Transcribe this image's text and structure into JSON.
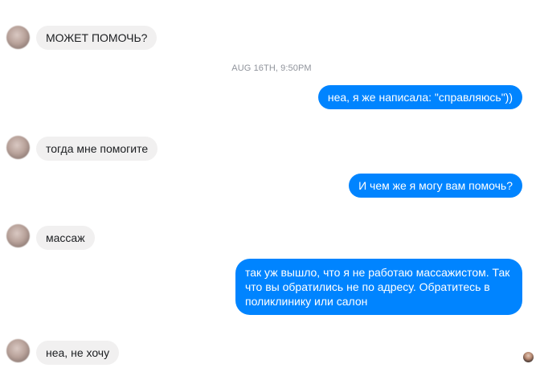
{
  "conversation": {
    "timestamp": "AUG 16TH, 9:50PM",
    "messages": [
      {
        "direction": "incoming",
        "text": "МОЖЕТ ПОМОЧЬ?"
      },
      {
        "direction": "outgoing",
        "text": "неа, я же написала: \"справляюсь\"))"
      },
      {
        "direction": "incoming",
        "text": "тогда мне помогите"
      },
      {
        "direction": "outgoing",
        "text": "И чем же я могу вам помочь?"
      },
      {
        "direction": "incoming",
        "text": "массаж"
      },
      {
        "direction": "outgoing",
        "text": "так уж вышло, что я не работаю массажистом. Так что вы обратились не по адресу. Обратитесь в поликлинику или салон"
      },
      {
        "direction": "incoming",
        "text": "неа, не хочу"
      }
    ]
  },
  "colors": {
    "outgoing_bubble": "#0084ff",
    "incoming_bubble": "#f1f0f0",
    "timestamp_text": "#90949c"
  },
  "icons": {
    "contact_avatar": "avatar",
    "seen_indicator": "seen-avatar-icon"
  }
}
